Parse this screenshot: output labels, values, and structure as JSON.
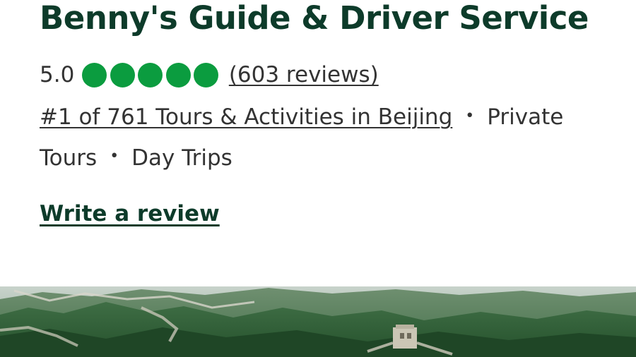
{
  "header": {
    "title": "Benny's Guide & Driver Service"
  },
  "rating": {
    "value": "5.0",
    "bubbles_filled": 5,
    "bubbles_total": 5,
    "bubble_color": "#0b9c3f",
    "reviews_link": "(603 reviews)"
  },
  "meta": {
    "rank": "#1 of 761 Tours & Activities in Beijing",
    "separator": "•",
    "category_1": "Private Tours",
    "category_2": "Day Trips"
  },
  "actions": {
    "write_review": "Write a review"
  },
  "colors": {
    "title": "#0d3b2a",
    "text": "#333333",
    "accent": "#0b9c3f"
  },
  "hero_image": {
    "icon": "great-wall-photo"
  }
}
